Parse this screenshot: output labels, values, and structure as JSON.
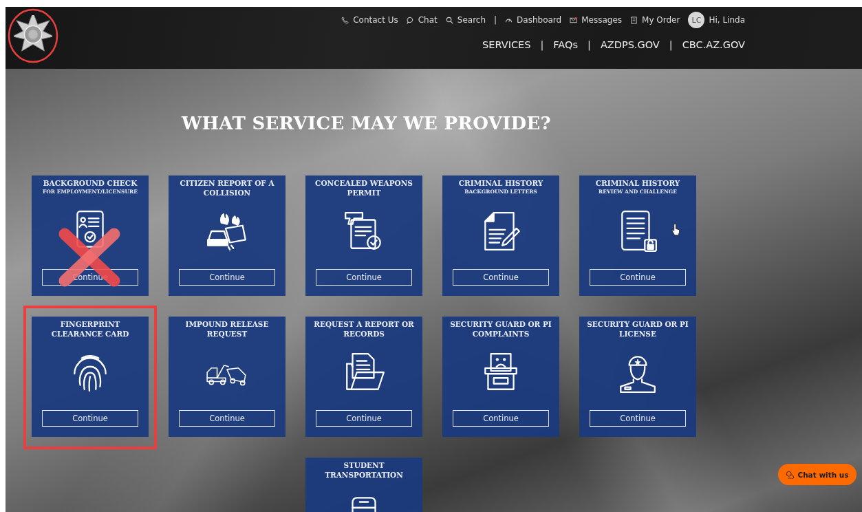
{
  "header": {
    "logo": {
      "circled": true
    },
    "top_links": [
      {
        "kind": "phone",
        "label": "Contact Us"
      },
      {
        "kind": "chat",
        "label": "Chat"
      },
      {
        "kind": "search",
        "label": "Search"
      },
      {
        "kind": "separator",
        "label": "|"
      },
      {
        "kind": "gauge",
        "label": "Dashboard"
      },
      {
        "kind": "mail",
        "label": "Messages"
      },
      {
        "kind": "order",
        "label": "My Order"
      },
      {
        "kind": "user",
        "avatar": "LC",
        "label": "Hi, Linda"
      }
    ],
    "nav": [
      {
        "kind": "link",
        "label": "SERVICES"
      },
      {
        "kind": "separator",
        "label": "|"
      },
      {
        "kind": "link",
        "label": "FAQs"
      },
      {
        "kind": "separator",
        "label": "|"
      },
      {
        "kind": "link",
        "label": "AZDPS.GOV"
      },
      {
        "kind": "separator",
        "label": "|"
      },
      {
        "kind": "link",
        "label": "CBC.AZ.GOV"
      }
    ]
  },
  "heading": "WHAT SERVICE MAY WE PROVIDE?",
  "services": [
    {
      "title": "BACKGROUND CHECK",
      "subtitle": "FOR EMPLOYMENT/LICENSURE",
      "button": "Continue",
      "crossed_out": true,
      "highlighted": false
    },
    {
      "title": "CITIZEN REPORT OF A COLLISION",
      "button": "Continue",
      "crossed_out": false,
      "highlighted": false
    },
    {
      "title": "CONCEALED WEAPONS PERMIT",
      "button": "Continue",
      "crossed_out": false,
      "highlighted": false
    },
    {
      "title": "CRIMINAL HISTORY",
      "subtitle": "BACKGROUND LETTERS",
      "button": "Continue",
      "crossed_out": false,
      "highlighted": false
    },
    {
      "title": "CRIMINAL HISTORY",
      "subtitle": "REVIEW AND CHALLENGE",
      "button": "Continue",
      "crossed_out": false,
      "highlighted": false
    },
    {
      "title": "FINGERPRINT CLEARANCE CARD",
      "button": "Continue",
      "crossed_out": false,
      "highlighted": true
    },
    {
      "title": "IMPOUND RELEASE REQUEST",
      "button": "Continue",
      "crossed_out": false,
      "highlighted": false
    },
    {
      "title": "REQUEST A REPORT OR RECORDS",
      "button": "Continue",
      "crossed_out": false,
      "highlighted": false
    },
    {
      "title": "SECURITY GUARD OR PI COMPLAINTS",
      "button": "Continue",
      "crossed_out": false,
      "highlighted": false
    },
    {
      "title": "SECURITY GUARD OR PI LICENSE",
      "button": "Continue",
      "crossed_out": false,
      "highlighted": false
    },
    {
      "title": "STUDENT TRANSPORTATION",
      "crossed_out": false,
      "highlighted": false
    }
  ],
  "chat_button": "Chat with us"
}
